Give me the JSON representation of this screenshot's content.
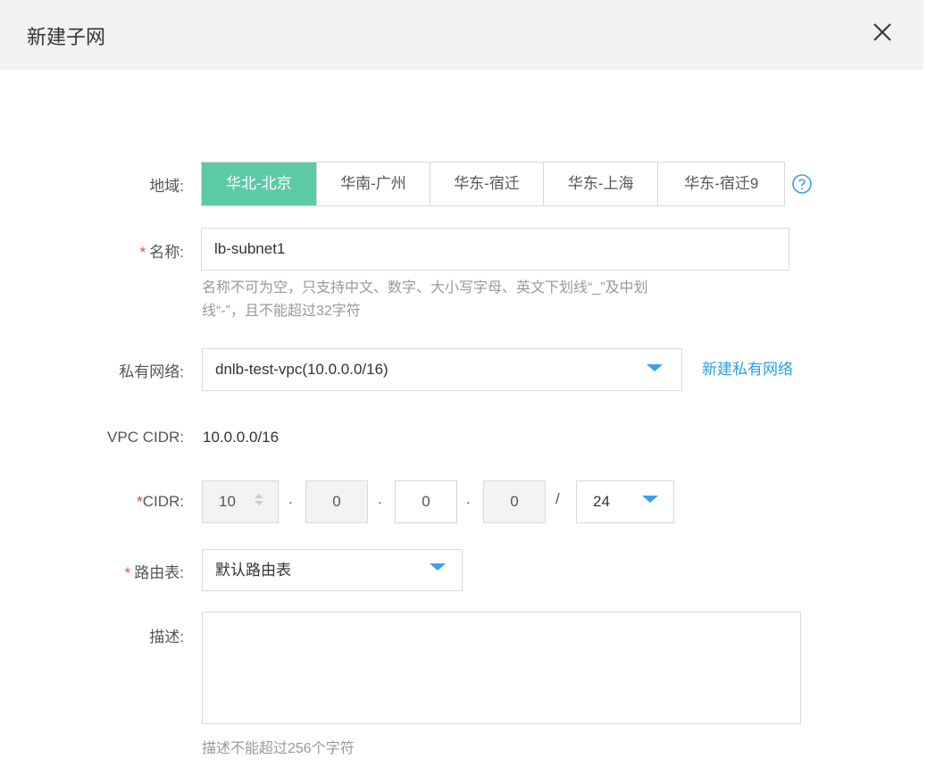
{
  "dialog": {
    "title": "新建子网"
  },
  "form": {
    "region": {
      "label": "地域:",
      "options": [
        "华北-北京",
        "华南-广州",
        "华东-宿迁",
        "华东-上海",
        "华东-宿迁9"
      ],
      "selected": "华北-北京"
    },
    "name": {
      "required_mark": "*",
      "label": "名称:",
      "value": "lb-subnet1",
      "hint_line1": "名称不可为空，只支持中文、数字、大小写字母、英文下划线“_”及中划",
      "hint_line2": "线“-”，且不能超过32字符"
    },
    "vpc": {
      "label": "私有网络:",
      "value": "dnlb-test-vpc(10.0.0.0/16)",
      "create_link": "新建私有网络"
    },
    "vpc_cidr": {
      "label": "VPC CIDR:",
      "value": "10.0.0.0/16"
    },
    "cidr": {
      "label": "*CIDR:",
      "octets": [
        "10",
        "0",
        "0",
        "0"
      ],
      "separator": ".",
      "slash": "/",
      "mask": "24"
    },
    "route_table": {
      "required_mark": "*",
      "label": "路由表:",
      "value": "默认路由表"
    },
    "description": {
      "label": "描述:",
      "value": "",
      "hint": "描述不能超过256个字符"
    }
  },
  "colors": {
    "active_region": "#5cc9a7",
    "link": "#29a0e8",
    "required": "#f04134"
  },
  "icons": {
    "close": "close-icon",
    "help": "help-circle-icon",
    "dropdown": "caret-down-icon",
    "stepper": "stepper-icon"
  }
}
